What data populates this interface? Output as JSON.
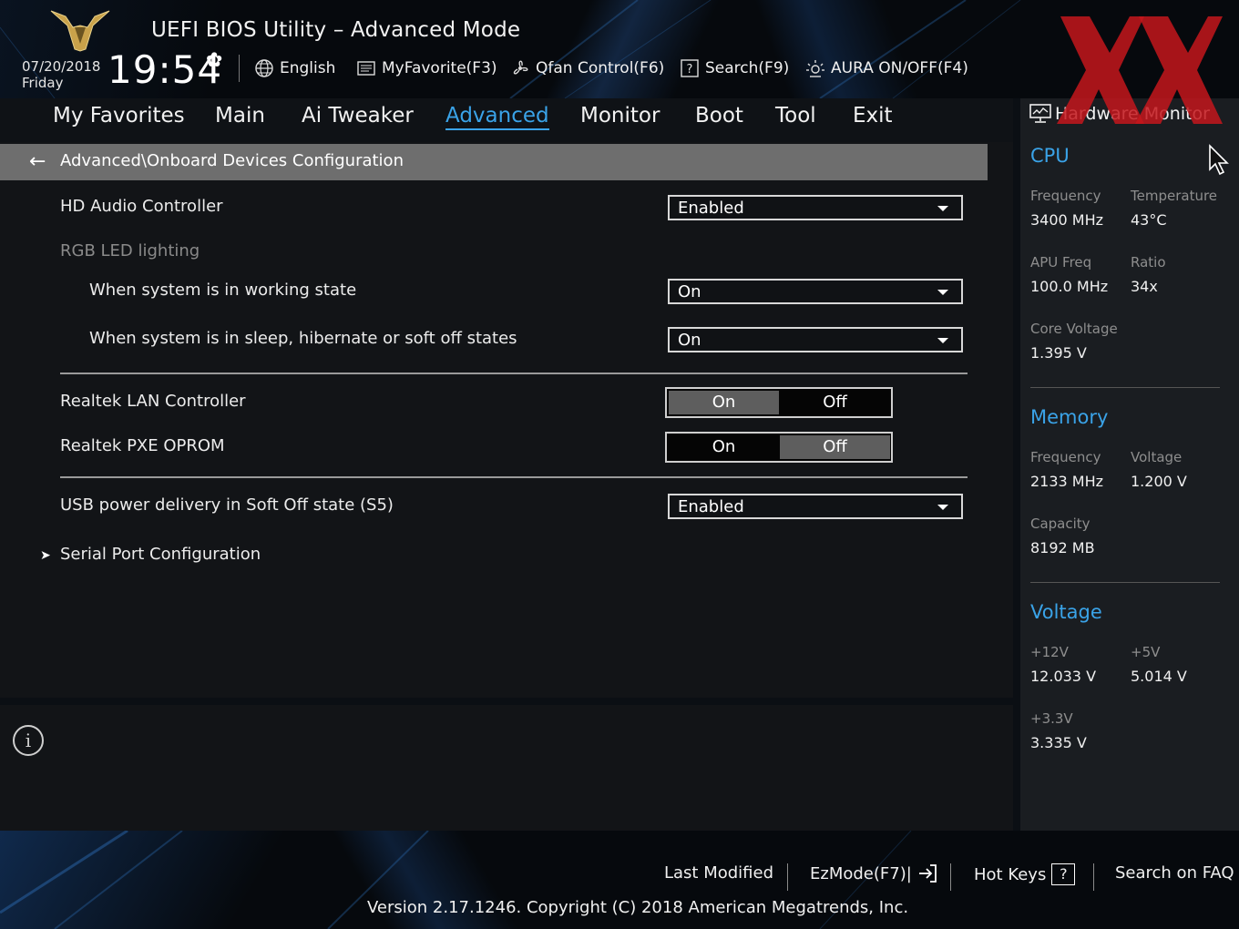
{
  "header": {
    "title": "UEFI BIOS Utility – Advanced Mode",
    "date": "07/20/2018",
    "day": "Friday",
    "time": "19:54",
    "tools": [
      {
        "label": "English",
        "icon": "globe-icon"
      },
      {
        "label": "MyFavorite(F3)",
        "icon": "favorite-list-icon"
      },
      {
        "label": "Qfan Control(F6)",
        "icon": "fan-icon"
      },
      {
        "label": "Search(F9)",
        "icon": "search-help-icon"
      },
      {
        "label": "AURA ON/OFF(F4)",
        "icon": "aura-light-icon"
      }
    ]
  },
  "nav": {
    "tabs": [
      "My Favorites",
      "Main",
      "Ai Tweaker",
      "Advanced",
      "Monitor",
      "Boot",
      "Tool",
      "Exit"
    ],
    "active": "Advanced"
  },
  "breadcrumb": "Advanced\\Onboard Devices Configuration",
  "settings": {
    "hd_audio": {
      "label": "HD Audio Controller",
      "value": "Enabled"
    },
    "rgb_header": "RGB LED lighting",
    "rgb_working": {
      "label": "When system is in working state",
      "value": "On"
    },
    "rgb_sleep": {
      "label": "When system is in sleep, hibernate or soft off states",
      "value": "On"
    },
    "lan": {
      "label": "Realtek LAN Controller",
      "on": "On",
      "off": "Off",
      "selected": "On"
    },
    "pxe": {
      "label": "Realtek PXE OPROM",
      "on": "On",
      "off": "Off",
      "selected": "Off"
    },
    "usb_power": {
      "label": "USB power delivery in Soft Off state (S5)",
      "value": "Enabled"
    },
    "serial_port": {
      "label": "Serial Port Configuration"
    }
  },
  "hardware_monitor": {
    "title": "Hardware Monitor",
    "cpu": {
      "heading": "CPU",
      "frequency_label": "Frequency",
      "frequency": "3400 MHz",
      "temperature_label": "Temperature",
      "temperature": "43°C",
      "apu_label": "APU Freq",
      "apu": "100.0 MHz",
      "ratio_label": "Ratio",
      "ratio": "34x",
      "core_voltage_label": "Core Voltage",
      "core_voltage": "1.395 V"
    },
    "memory": {
      "heading": "Memory",
      "frequency_label": "Frequency",
      "frequency": "2133 MHz",
      "voltage_label": "Voltage",
      "voltage": "1.200 V",
      "capacity_label": "Capacity",
      "capacity": "8192 MB"
    },
    "voltage": {
      "heading": "Voltage",
      "v12_label": "+12V",
      "v12": "12.033 V",
      "v5_label": "+5V",
      "v5": "5.014 V",
      "v33_label": "+3.3V",
      "v33": "3.335 V"
    }
  },
  "footer": {
    "last_modified": "Last Modified",
    "ezmode": "EzMode(F7)|",
    "hotkeys": "Hot Keys",
    "hotkeys_key": "?",
    "faq": "Search on FAQ",
    "copyright": "Version 2.17.1246. Copyright (C) 2018 American Megatrends, Inc."
  },
  "colors": {
    "accent": "#3aa3e8",
    "watermark": "#c4161c",
    "selected_segment": "#5e5e5e"
  }
}
